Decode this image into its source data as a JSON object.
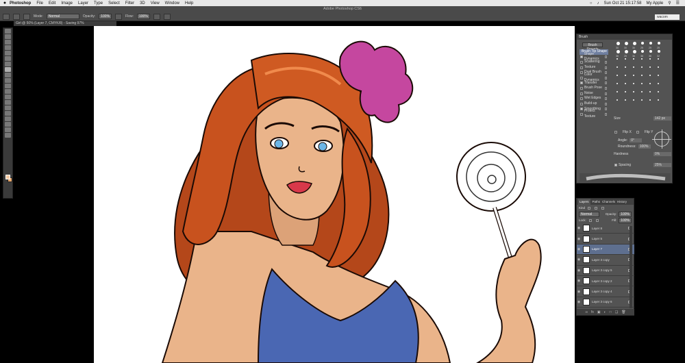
{
  "menubar": {
    "apple": "",
    "app_name": "Photoshop",
    "menus": [
      "File",
      "Edit",
      "Image",
      "Layer",
      "Type",
      "Select",
      "Filter",
      "3D",
      "View",
      "Window",
      "Help"
    ],
    "clock": "Sun Oct 21  15:17:58",
    "user": "My Apple"
  },
  "options": {
    "window_title": "Adobe Photoshop CS6",
    "mode_label": "Mode:",
    "mode_value": "Normal",
    "opacity_label": "Opacity:",
    "opacity_value": "100%",
    "flow_label": "Flow:",
    "flow_value": "100%",
    "search_value": "wacom"
  },
  "document": {
    "tab_title": "Girl @ 50% (Layer 7, CMYK/8) - Saving 97%"
  },
  "brush_panel": {
    "title": "Brush",
    "presets_button": "Brush Presets",
    "options": [
      {
        "label": "Brush Tip Shape",
        "checked": false,
        "active": true
      },
      {
        "label": "Shape Dynamics",
        "checked": true,
        "active": false
      },
      {
        "label": "Scattering",
        "checked": false,
        "active": false
      },
      {
        "label": "Texture",
        "checked": false,
        "active": false
      },
      {
        "label": "Dual Brush",
        "checked": false,
        "active": false
      },
      {
        "label": "Color Dynamics",
        "checked": false,
        "active": false
      },
      {
        "label": "Transfer",
        "checked": true,
        "active": false
      },
      {
        "label": "Brush Pose",
        "checked": false,
        "active": false
      },
      {
        "label": "Noise",
        "checked": false,
        "active": false
      },
      {
        "label": "Wet Edges",
        "checked": false,
        "active": false
      },
      {
        "label": "Build-up",
        "checked": false,
        "active": false
      },
      {
        "label": "Smoothing",
        "checked": true,
        "active": false
      },
      {
        "label": "Protect Texture",
        "checked": false,
        "active": false
      }
    ],
    "tip_sizes": [
      "30",
      "30",
      "30",
      "25",
      "25",
      "25",
      "36",
      "25",
      "36",
      "36",
      "36",
      "32"
    ],
    "size_label": "Size",
    "size_value": "142 px",
    "flip_x": "Flip X",
    "flip_y": "Flip Y",
    "angle_label": "Angle:",
    "angle_value": "0°",
    "roundness_label": "Roundness:",
    "roundness_value": "100%",
    "hardness_label": "Hardness",
    "hardness_value": "0%",
    "spacing_label": "Spacing",
    "spacing_value": "25%"
  },
  "layers_panel": {
    "tabs": [
      "Layers",
      "Paths",
      "Channels",
      "History"
    ],
    "kind_label": "Kind",
    "blend_mode": "Normal",
    "opacity_label": "Opacity:",
    "opacity_value": "100%",
    "lock_label": "Lock:",
    "fill_label": "Fill:",
    "fill_value": "100%",
    "layers": [
      {
        "name": "Layer 8",
        "selected": false
      },
      {
        "name": "Layer 5",
        "selected": false
      },
      {
        "name": "Layer 7",
        "selected": true
      },
      {
        "name": "Layer 3 copy",
        "selected": false
      },
      {
        "name": "Layer 3 copy 5",
        "selected": false
      },
      {
        "name": "Layer 3 copy 2",
        "selected": false
      },
      {
        "name": "Layer 3 copy 4",
        "selected": false
      },
      {
        "name": "Layer 3 copy 6",
        "selected": false
      }
    ]
  },
  "colors": {
    "hair": "#c8521e",
    "hair_shadow": "#8e2e10",
    "skin": "#eab48a",
    "dress": "#4a67b3",
    "bow": "#c5479f",
    "eyes": "#6cb6e8"
  }
}
